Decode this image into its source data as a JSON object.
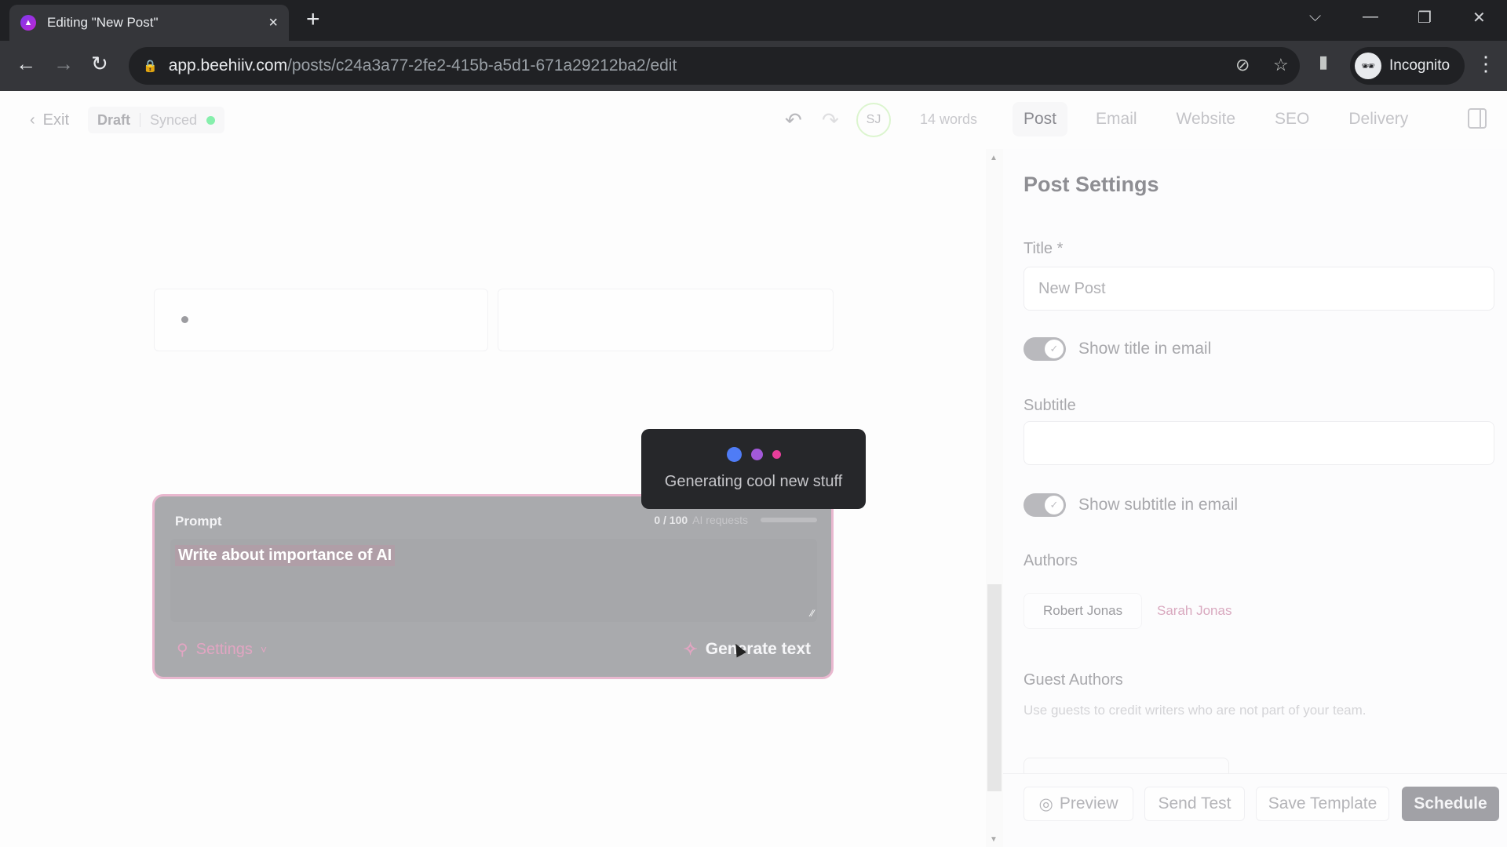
{
  "browser": {
    "tab_title": "Editing \"New Post\"",
    "tab_close": "×",
    "new_tab": "+",
    "url_host": "app.beehiiv.com",
    "url_path": "/posts/c24a3a77-2fe2-415b-a5d1-671a29212ba2/edit",
    "profile_label": "Incognito",
    "win_controls": {
      "tabsearch": "⌵",
      "minimize": "—",
      "restore": "❐",
      "close": "✕"
    },
    "nav": {
      "back": "←",
      "forward": "→",
      "reload": "↻"
    },
    "icons": {
      "lock": "🔒",
      "eye_off": "⊘",
      "star": "☆",
      "sidepanel": "▮",
      "menu": "⋮",
      "incognito": "🕶"
    }
  },
  "header": {
    "exit_icon": "‹",
    "exit_label": "Exit",
    "status_draft": "Draft",
    "status_synced": "Synced",
    "undo_icon": "↶",
    "redo_icon": "↷",
    "avatar_initials": "SJ",
    "word_count": "14 words",
    "tabs": [
      {
        "label": "Post",
        "active": true
      },
      {
        "label": "Email",
        "active": false
      },
      {
        "label": "Website",
        "active": false
      },
      {
        "label": "SEO",
        "active": false
      },
      {
        "label": "Delivery",
        "active": false
      }
    ]
  },
  "editor": {
    "prompt": {
      "label": "Prompt",
      "ai_count": "0 / 100",
      "ai_label": "AI requests",
      "ai_usage_fraction": 0.0,
      "text": "Write about importance of AI",
      "resize_icon": "⁄⁄",
      "settings_icon": "⚲",
      "settings_label": "Settings",
      "settings_chevron": "˅",
      "generate_icon": "✧",
      "generate_label": "Generate text"
    },
    "toast": {
      "text": "Generating cool new stuff",
      "dot_colors": [
        "#4f7cf6",
        "#a259d9",
        "#e83e9b"
      ]
    }
  },
  "sidepanel": {
    "title": "Post Settings",
    "title_label": "Title *",
    "title_value": "New Post",
    "show_title_label": "Show title in email",
    "show_title_on": true,
    "subtitle_label": "Subtitle",
    "subtitle_value": "",
    "show_subtitle_label": "Show subtitle in email",
    "show_subtitle_on": true,
    "check_icon": "✓",
    "authors_label": "Authors",
    "authors": [
      {
        "name": "Robert Jonas",
        "selected": true
      },
      {
        "name": "Sarah Jonas",
        "selected": false
      }
    ],
    "guest_label": "Guest Authors",
    "guest_helper": "Use guests to credit writers who are not part of your team.",
    "footer": {
      "preview_icon": "◎",
      "preview": "Preview",
      "send_test": "Send Test",
      "save_template": "Save Template",
      "schedule": "Schedule"
    }
  },
  "scroll": {
    "up": "▲",
    "down": "▼"
  }
}
